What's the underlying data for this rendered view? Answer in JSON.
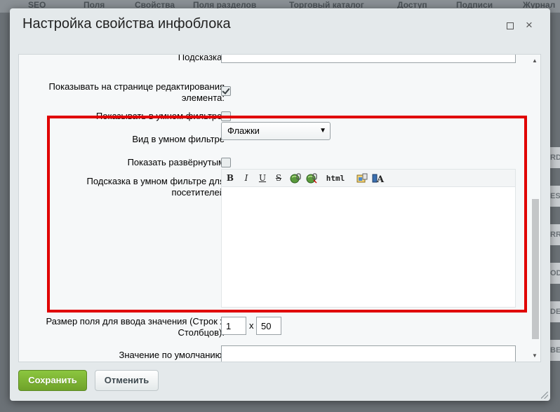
{
  "background": {
    "tabs": [
      "SEO",
      "Поля",
      "Свойства",
      "Поля разделов",
      "Торговый каталог",
      "Доступ",
      "Подписи",
      "Журнал"
    ],
    "right_fragments": [
      "RD",
      "ES",
      "RR",
      "OD",
      "DE",
      "BE"
    ]
  },
  "dialog": {
    "title": "Настройка свойства инфоблока",
    "maximize_icon": "maximize-icon",
    "close_icon": "close-icon",
    "close_glyph": "×"
  },
  "form": {
    "hint_label": "Подсказка:",
    "show_on_edit_label": "Показывать на странице редактирования элемента:",
    "show_on_edit_label_line1": "Показывать на странице редактирования",
    "show_on_edit_label_line2": "элемента:",
    "show_on_edit_checked": true,
    "show_in_smart_filter_label": "Показывать в умном фильтре:",
    "show_in_smart_filter_checked": false,
    "smart_filter_view_label": "Вид в умном фильтре",
    "smart_filter_view_value": "Флажки",
    "show_expanded_label": "Показать развёрнутым",
    "show_expanded_checked": false,
    "smart_filter_hint_label_line1": "Подсказка в умном фильтре для",
    "smart_filter_hint_label_line2": "посетителей",
    "field_size_label_line1": "Размер поля для ввода значения (Строк x",
    "field_size_label_line2": "Столбцов):",
    "field_rows": "1",
    "field_separator": "x",
    "field_cols": "50",
    "default_value_label": "Значение по умолчанию:"
  },
  "editor_toolbar": {
    "bold": "B",
    "italic": "I",
    "underline": "U",
    "strike": "S",
    "html": "html",
    "icons": [
      "bold-icon",
      "italic-icon",
      "underline-icon",
      "strikethrough-icon",
      "insert-link-icon",
      "remove-link-icon",
      "html-mode-icon",
      "insert-image-icon",
      "font-color-icon"
    ]
  },
  "buttons": {
    "save": "Сохранить",
    "cancel": "Отменить"
  },
  "colors": {
    "highlight_box": "#e00000",
    "save_button": "#7ab534"
  }
}
